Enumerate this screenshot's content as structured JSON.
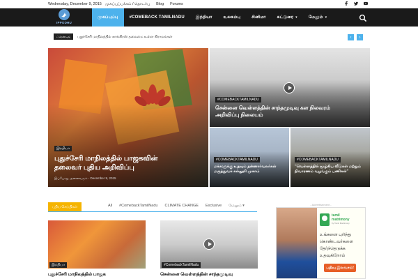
{
  "topbar": {
    "date": "Wednesday, December 9, 2015",
    "links": [
      "முகப்புப்பக்கம் / தொடர்பு",
      "Blog",
      "Forums"
    ],
    "social_icons": [
      "facebook-icon",
      "twitter-icon",
      "youtube-icon"
    ]
  },
  "logo": {
    "text": "IPPODHU"
  },
  "nav": {
    "items": [
      {
        "label": "முகப்புப்பு",
        "active": true,
        "caret": ""
      },
      {
        "label": "#COMEBACK TAMILNADU",
        "active": false,
        "caret": ""
      },
      {
        "label": "இந்தியா",
        "active": false,
        "caret": ""
      },
      {
        "label": "உலகம்பு",
        "active": false,
        "caret": ""
      },
      {
        "label": "சினிமா",
        "active": false,
        "caret": ""
      },
      {
        "label": "கட்டுரை",
        "active": false,
        "caret": "▾"
      },
      {
        "label": "மேலும்",
        "active": false,
        "caret": "▾"
      }
    ],
    "search_icon": "search-icon"
  },
  "trending": {
    "label": "ட்ரெண்டிங்",
    "text": "புதுச்சேரி மாநிலத்தில் காங்கிரஸ் தலைமை உள்ள கிராமங்கள்",
    "prev": "‹",
    "next": "›"
  },
  "hero": {
    "main": {
      "category": "இந்தியா",
      "title_line1": "புதுச்சேரி மாநிலத்தில் பாஜகவின்",
      "title_line2": "தலைவர் புதிய அறிவிப்பு",
      "meta": "இப்போது அனைவரும் - December 9, 2015"
    },
    "top_right": {
      "category": "#COMEBACKTAMILNADU",
      "title_line1": "சென்னை வெள்ளத்தின் சாந்தமுடிவு கள நிலவரம்",
      "title_line2": "அறிவிப்பு நிலையம்"
    },
    "bottom_left": {
      "category": "#COMEBACKTAMILNADU",
      "title_line1": "மக்களுக்கு உதவும் தன்னார்வலர்கள்",
      "title_line2": "மருத்துவக் கல்லூரி முகாம்"
    },
    "bottom_right": {
      "category": "#COMEBACKTAMILNADU",
      "title_line1": "\"வெள்ளத்தில் மூழ்கிய வீடுகள் மற்றும்",
      "title_line2": "நிவாரணம் வழங்கும் பணிகள்\""
    }
  },
  "section": {
    "tag": "புதிய செய்திகள்",
    "tabs": [
      "All",
      "#ComebackTamilNadu",
      "CLIMATE CHANGE",
      "Exclusive",
      "மேலும்"
    ],
    "more_caret": "▾"
  },
  "cards": [
    {
      "category": "இந்தியா",
      "title": "புதுச்சேரி மாநிலத்தில் பாஜக"
    },
    {
      "category": "#ComebackTamilNadu",
      "title": "சென்னை வெள்ளத்தின் சாந்தமுடிவு"
    }
  ],
  "ad": {
    "label": "- Advertisement -",
    "brand_line1": "tamil",
    "brand_line2": "matrimony",
    "brand_sub": "by Tamil Matrimony",
    "line1": "உங்களை புரிந்து",
    "line2": "கொண்டவர்களை",
    "line3": "தேர்ந்தெடுக்க",
    "line4": "உதவுகிறோம்",
    "cta": "பதிவு இலவசம்!"
  },
  "colors": {
    "accent": "#4db2ec",
    "nav_bg": "#1a1a1a",
    "section_tag": "#f5b400",
    "ad_cta": "#e75f26"
  }
}
